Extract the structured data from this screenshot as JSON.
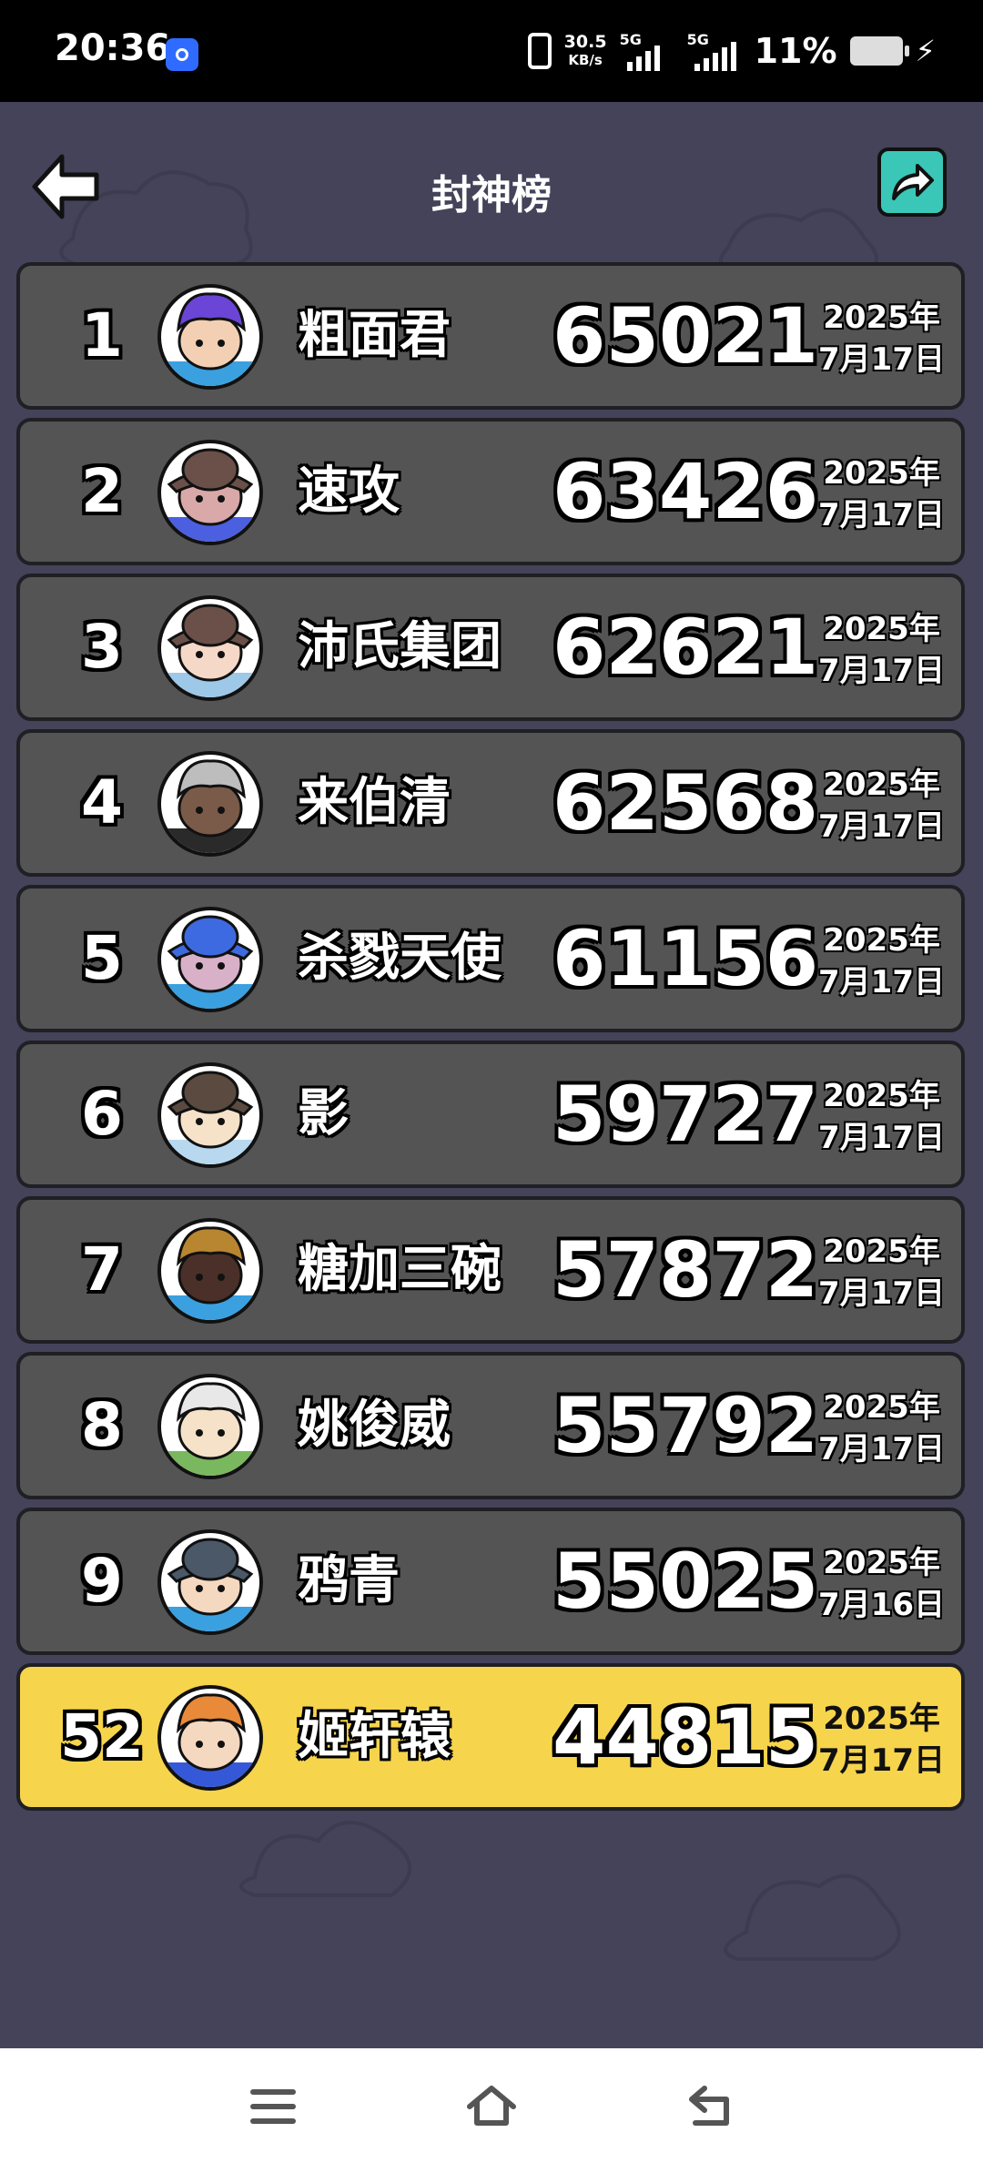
{
  "status_bar": {
    "time": "20:36",
    "net_speed_value": "30.5",
    "net_speed_unit": "KB/s",
    "sim1_label": "5G",
    "sim2_label": "5G",
    "battery_percent": "11%"
  },
  "header": {
    "title": "封神榜",
    "back_icon": "arrow-left-icon",
    "share_icon": "share-arrow-icon"
  },
  "leaderboard": [
    {
      "rank": "1",
      "name": "粗面君",
      "score": "65021",
      "date_year": "2025年",
      "date_day": "7月17日",
      "avatar": {
        "hair": "#6b45d6",
        "skin": "#f3d0b4",
        "shirt": "#3aa0e0",
        "hat": null
      }
    },
    {
      "rank": "2",
      "name": "速攻",
      "score": "63426",
      "date_year": "2025年",
      "date_day": "7月17日",
      "avatar": {
        "hair": "#6a5048",
        "skin": "#d9a8a8",
        "shirt": "#4b5fe0",
        "hat": "#6a5048"
      }
    },
    {
      "rank": "3",
      "name": "沛氏集团",
      "score": "62621",
      "date_year": "2025年",
      "date_day": "7月17日",
      "avatar": {
        "hair": "#6a5048",
        "skin": "#f5d8c8",
        "shirt": "#9ec8e8",
        "hat": "#6a5048"
      }
    },
    {
      "rank": "4",
      "name": "来伯清",
      "score": "62568",
      "date_year": "2025年",
      "date_day": "7月17日",
      "avatar": {
        "hair": "#bdbdbd",
        "skin": "#7a5a48",
        "shirt": "#2a2a2a",
        "hat": null
      }
    },
    {
      "rank": "5",
      "name": "杀戮天使",
      "score": "61156",
      "date_year": "2025年",
      "date_day": "7月17日",
      "avatar": {
        "hair": "#3d6ae0",
        "skin": "#d8b0c8",
        "shirt": "#3aa0e0",
        "hat": "#3d6ae0"
      }
    },
    {
      "rank": "6",
      "name": "影",
      "score": "59727",
      "date_year": "2025年",
      "date_day": "7月17日",
      "avatar": {
        "hair": "#5a4a40",
        "skin": "#f5e2c8",
        "shirt": "#b8d8f0",
        "hat": "#5a4a40"
      }
    },
    {
      "rank": "7",
      "name": "糖加三碗",
      "score": "57872",
      "date_year": "2025年",
      "date_day": "7月17日",
      "avatar": {
        "hair": "#b88630",
        "skin": "#4a3028",
        "shirt": "#3aa0e0",
        "hat": null
      }
    },
    {
      "rank": "8",
      "name": "姚俊威",
      "score": "55792",
      "date_year": "2025年",
      "date_day": "7月17日",
      "avatar": {
        "hair": "#e8e8e8",
        "skin": "#f5e2c8",
        "shirt": "#7ab860",
        "hat": null
      }
    },
    {
      "rank": "9",
      "name": "鸦青",
      "score": "55025",
      "date_year": "2025年",
      "date_day": "7月16日",
      "avatar": {
        "hair": "#4a5868",
        "skin": "#f5d8c0",
        "shirt": "#3aa0e0",
        "hat": "#4a5868"
      }
    },
    {
      "rank": "52",
      "name": "姬轩辕",
      "score": "44815",
      "date_year": "2025年",
      "date_day": "7月17日",
      "avatar": {
        "hair": "#e88a3a",
        "skin": "#f5d8c0",
        "shirt": "#3558d8",
        "hat": null
      },
      "is_self": true
    }
  ],
  "colors": {
    "background": "#44435a",
    "row": "#545454",
    "self_row": "#f6d44c",
    "share_button": "#3ac7b8"
  },
  "nav_bar": {
    "menu_icon": "menu-lines-icon",
    "home_icon": "home-icon",
    "back_icon": "back-return-icon"
  }
}
